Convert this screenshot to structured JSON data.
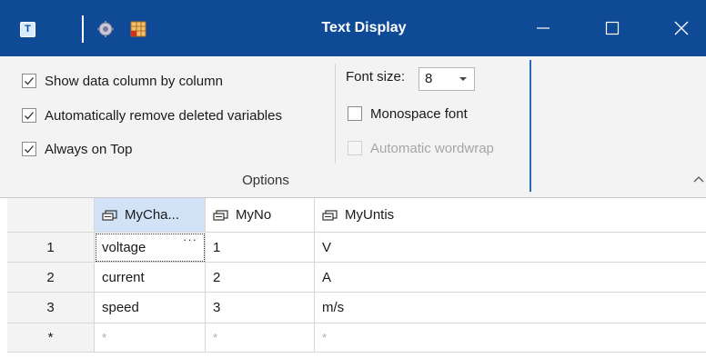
{
  "window": {
    "title": "Text Display",
    "app_icon_glyph": "T",
    "icons": [
      "text-display-app-icon",
      "gear-icon",
      "table-settings-icon",
      "minimize-icon",
      "maximize-icon",
      "close-icon"
    ]
  },
  "options": {
    "group_label": "Options",
    "checkboxes": [
      {
        "label": "Show data column by column",
        "checked": true,
        "enabled": true
      },
      {
        "label": "Automatically remove deleted variables",
        "checked": true,
        "enabled": true
      },
      {
        "label": "Always on Top",
        "checked": true,
        "enabled": true
      }
    ],
    "font_size_label": "Font size:",
    "font_size_value": "8",
    "monospace_label": "Monospace font",
    "monospace_checked": false,
    "wordwrap_label": "Automatic wordwrap",
    "wordwrap_checked": false,
    "wordwrap_enabled": false
  },
  "grid": {
    "columns": [
      {
        "name": "MyCha..."
      },
      {
        "name": "MyNo"
      },
      {
        "name": "MyUntis"
      }
    ],
    "rows": [
      {
        "header": "1",
        "cells": [
          "voltage",
          "1",
          "V"
        ]
      },
      {
        "header": "2",
        "cells": [
          "current",
          "2",
          "A"
        ]
      },
      {
        "header": "3",
        "cells": [
          "speed",
          "3",
          "m/s"
        ]
      }
    ],
    "new_row": {
      "header": "*",
      "cells": [
        "*",
        "*",
        "*"
      ]
    },
    "ellipsis_label": "···"
  },
  "colors": {
    "titlebar": "#0f4a96",
    "ribbon": "#f3f3f3",
    "active_header": "#d3e3f7"
  }
}
